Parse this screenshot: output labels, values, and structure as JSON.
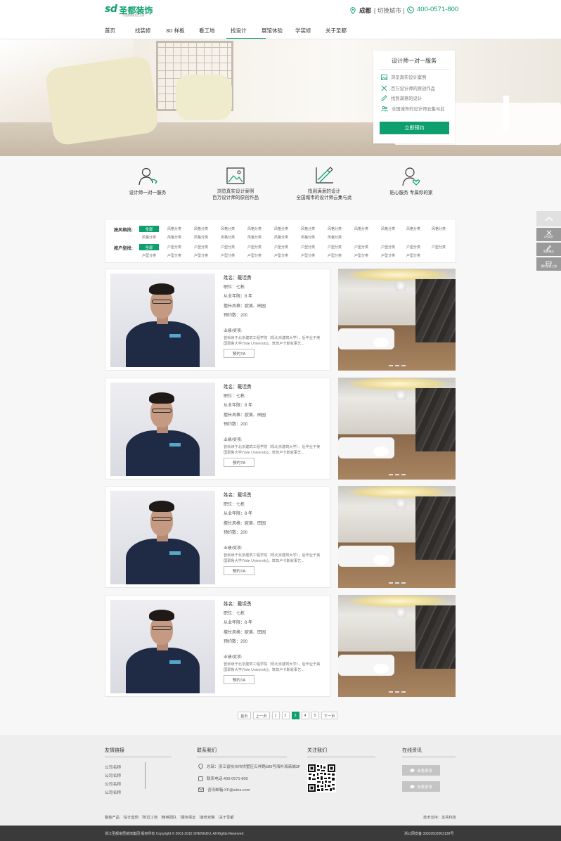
{
  "brand": {
    "mark": "sd",
    "name": "圣都装饰",
    "slogan": "中国健康家居生态家",
    "color": "#0e9f6e"
  },
  "header": {
    "city": "成都",
    "switch_city": "[ 切换城市 ]",
    "phone": "400-0571-800"
  },
  "nav": {
    "items": [
      "首页",
      "找装修",
      "3D 样板",
      "看工地",
      "找设计",
      "展馆体验",
      "学装修",
      "关于圣都"
    ],
    "active_index": 4
  },
  "banner_card": {
    "title": "设计师一对一服务",
    "items": [
      {
        "icon": "image-icon",
        "text": "浏览真实设计案例"
      },
      {
        "icon": "tools-icon",
        "text": "百万设计师的原创作品"
      },
      {
        "icon": "pencil-icon",
        "text": "找到满意的设计"
      },
      {
        "icon": "group-icon",
        "text": "全国城市的设计师云集与此"
      }
    ],
    "button": "立即预约"
  },
  "features": [
    {
      "icon": "designer-icon",
      "line1": "设计师一对一服务",
      "line2": ""
    },
    {
      "icon": "gallery-icon",
      "line1": "浏览真实设计案例",
      "line2": "百万设计师的原创作品"
    },
    {
      "icon": "drawing-icon",
      "line1": "找到满意的设计",
      "line2": "全国城市的设计师云集与此"
    },
    {
      "icon": "heart-user-icon",
      "line1": "贴心服务  专属你的家",
      "line2": ""
    }
  ],
  "filters": {
    "style": {
      "label": "按风格找:",
      "all": "全部",
      "row1": [
        "风格分类",
        "风格分类",
        "风格分类",
        "风格分类",
        "风格分类",
        "风格分类",
        "风格分类",
        "风格分类",
        "风格分类",
        "风格分类",
        "风格分类"
      ],
      "row2": [
        "风格分类",
        "风格分类",
        "风格分类",
        "风格分类",
        "风格分类",
        "风格分类",
        "风格分类",
        "风格分类"
      ]
    },
    "layout": {
      "label": "按户型找:",
      "all": "全部",
      "row1": [
        "户型分类",
        "户型分类",
        "户型分类",
        "户型分类",
        "户型分类",
        "户型分类",
        "户型分类",
        "户型分类",
        "户型分类",
        "户型分类",
        "户型分类"
      ],
      "row2": [
        "户型分类",
        "户型分类",
        "户型分类",
        "户型分类",
        "户型分类",
        "户型分类",
        "户型分类",
        "户型分类",
        "户型分类",
        "户型分类",
        "户型分类"
      ]
    }
  },
  "designers": [
    {
      "name": "姓名：戴坦勇",
      "title": "职位：七栋",
      "years": "从业年限：8 年",
      "style": "擅长风格：欧美、田园",
      "count": "预约数：200",
      "bio_label": "业绩/奖项:",
      "bio_line1": "曾就读于北京建筑工程学院（现北京建筑大学），后毕业于美",
      "bio_line2": "国耶鲁大学(Yale University)。筑筑卢卡斯就事艺...",
      "button": "预约TA"
    },
    {
      "name": "姓名：戴坦勇",
      "title": "职位：七栋",
      "years": "从业年限：8 年",
      "style": "擅长风格：欧美、田园",
      "count": "预约数：200",
      "bio_label": "业绩/奖项:",
      "bio_line1": "曾就读于北京建筑工程学院（现北京建筑大学），后毕业于美",
      "bio_line2": "国耶鲁大学(Yale University)。筑筑卢卡斯就事艺...",
      "button": "预约TA"
    },
    {
      "name": "姓名：戴坦勇",
      "title": "职位：七栋",
      "years": "从业年限：8 年",
      "style": "擅长风格：欧美、田园",
      "count": "预约数：200",
      "bio_label": "业绩/奖项:",
      "bio_line1": "曾就读于北京建筑工程学院（现北京建筑大学），后毕业于美",
      "bio_line2": "国耶鲁大学(Yale University)。筑筑卢卡斯就事艺...",
      "button": "预约TA"
    },
    {
      "name": "姓名：戴坦勇",
      "title": "职位：七栋",
      "years": "从业年限：8 年",
      "style": "擅长风格：欧美、田园",
      "count": "预约数：200",
      "bio_label": "业绩/奖项:",
      "bio_line1": "曾就读于北京建筑工程学院（现北京建筑大学），后毕业于美",
      "bio_line2": "国耶鲁大学(Yale University)。筑筑卢卡斯就事艺...",
      "button": "预约TA"
    }
  ],
  "pager": {
    "first": "首页",
    "prev": "上一页",
    "pages": [
      "1",
      "2",
      "3",
      "4",
      "5"
    ],
    "active_page": "3",
    "next": "下一页"
  },
  "side": {
    "items": [
      "0元设计",
      "免费报价",
      "我的装修"
    ],
    "sub": [
      "预约装修工地"
    ]
  },
  "footer": {
    "links_title": "友情链接",
    "links": [
      "公司名称",
      "公司名称",
      "公司名称",
      "公司名称"
    ],
    "contact_title": "联系我们",
    "address": "总部：浙江省杭州市拱墅区石祥路589号海外海商城3F",
    "phone": "联系电话:400-0571-800",
    "email": "咨讯邮箱:XF@sdzs.com",
    "follow_title": "关注我们",
    "news_title": "在线资讯",
    "news_buttons": [
      "业务资讯",
      "业务资讯"
    ],
    "nav": [
      "整装产品",
      "设计案例",
      "附近工地",
      "精英团队",
      "服务保证",
      "装修攻略",
      "关于圣都"
    ],
    "support": "技术支持：龙兵科技",
    "copyright": "浙江圣都家居装饰集团 版权所有 Copyright © 2001-2016 SHENGDU, All Rights Reserved",
    "icp": "浙公网安备 33010502002139号"
  }
}
